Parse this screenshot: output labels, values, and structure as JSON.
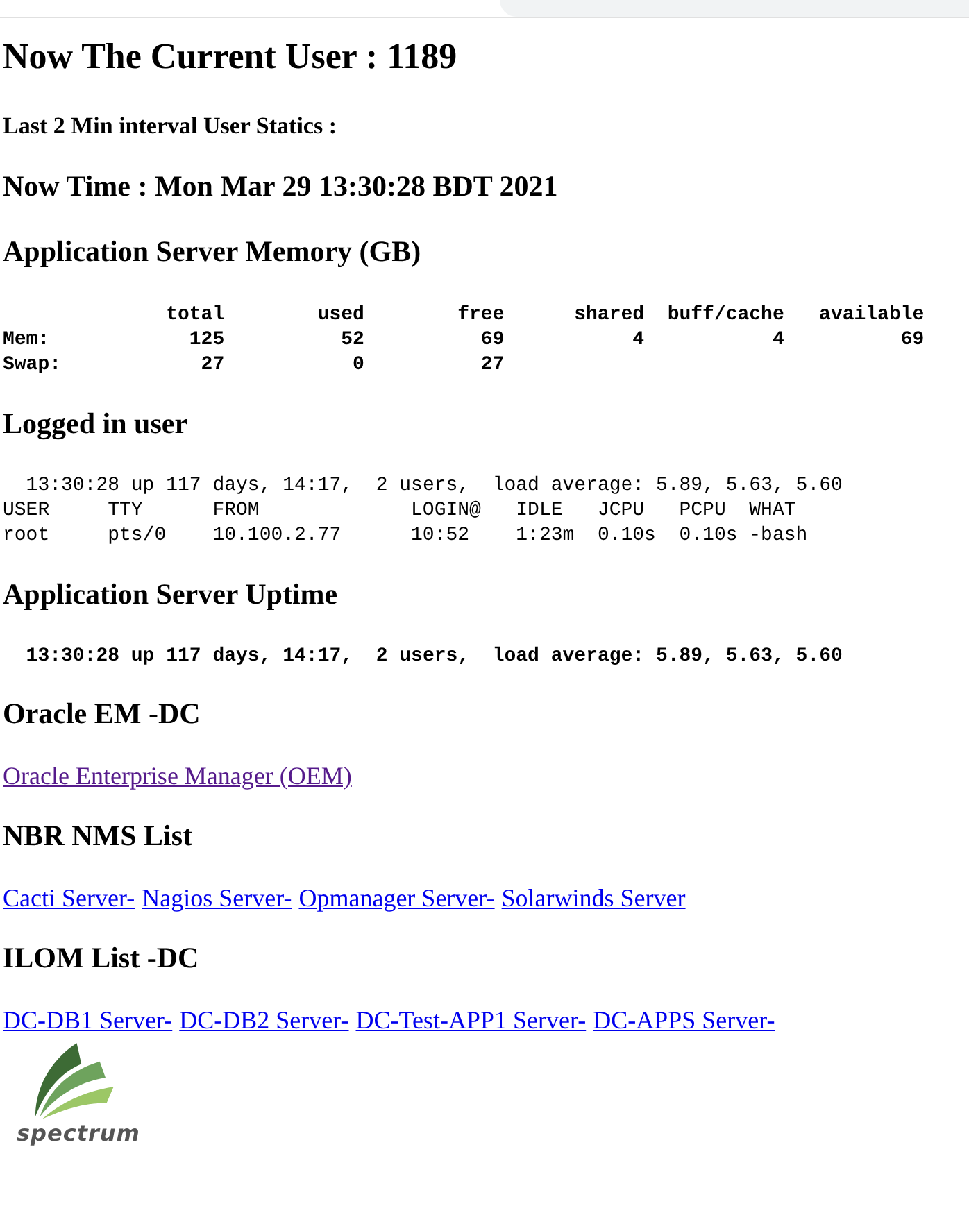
{
  "title": "Now The Current User : 1189",
  "subtitle": "Last 2 Min interval User Statics :",
  "now_time": "Now Time : Mon Mar 29 13:30:28 BDT 2021",
  "memory": {
    "heading": "Application Server Memory (GB)",
    "columns": [
      "total",
      "used",
      "free",
      "shared",
      "buff/cache",
      "available"
    ],
    "rows": [
      {
        "label": "Mem:",
        "values": [
          "125",
          "52",
          "69",
          "4",
          "4",
          "69"
        ]
      },
      {
        "label": "Swap:",
        "values": [
          "27",
          "0",
          "27"
        ]
      }
    ]
  },
  "logged_in": {
    "heading": "Logged in user",
    "summary": "13:30:28 up 117 days, 14:17,  2 users,  load average: 5.89, 5.63, 5.60",
    "columns": [
      "USER",
      "TTY",
      "FROM",
      "LOGIN@",
      "IDLE",
      "JCPU",
      "PCPU",
      "WHAT"
    ],
    "rows": [
      [
        "root",
        "pts/0",
        "10.100.2.77",
        "10:52",
        "1:23m",
        "0.10s",
        "0.10s",
        "-bash"
      ]
    ]
  },
  "uptime": {
    "heading": "Application Server Uptime",
    "line": "13:30:28 up 117 days, 14:17,  2 users,  load average: 5.89, 5.63, 5.60"
  },
  "link_sections": [
    {
      "heading": "Oracle EM -DC",
      "links": [
        {
          "label": "Oracle Enterprise Manager (OEM)",
          "visited": true
        }
      ]
    },
    {
      "heading": "NBR NMS List",
      "links": [
        {
          "label": "Cacti Server-",
          "visited": false
        },
        {
          "label": "Nagios Server-",
          "visited": false
        },
        {
          "label": "Opmanager Server-",
          "visited": false
        },
        {
          "label": "Solarwinds Server",
          "visited": false
        }
      ]
    },
    {
      "heading": "ILOM List -DC",
      "links": [
        {
          "label": "DC-DB1 Server-",
          "visited": false
        },
        {
          "label": "DC-DB2 Server-",
          "visited": false
        },
        {
          "label": "DC-Test-APP1 Server-",
          "visited": false
        },
        {
          "label": "DC-APPS Server-",
          "visited": false
        }
      ]
    }
  ],
  "logo_text": "spectrum"
}
